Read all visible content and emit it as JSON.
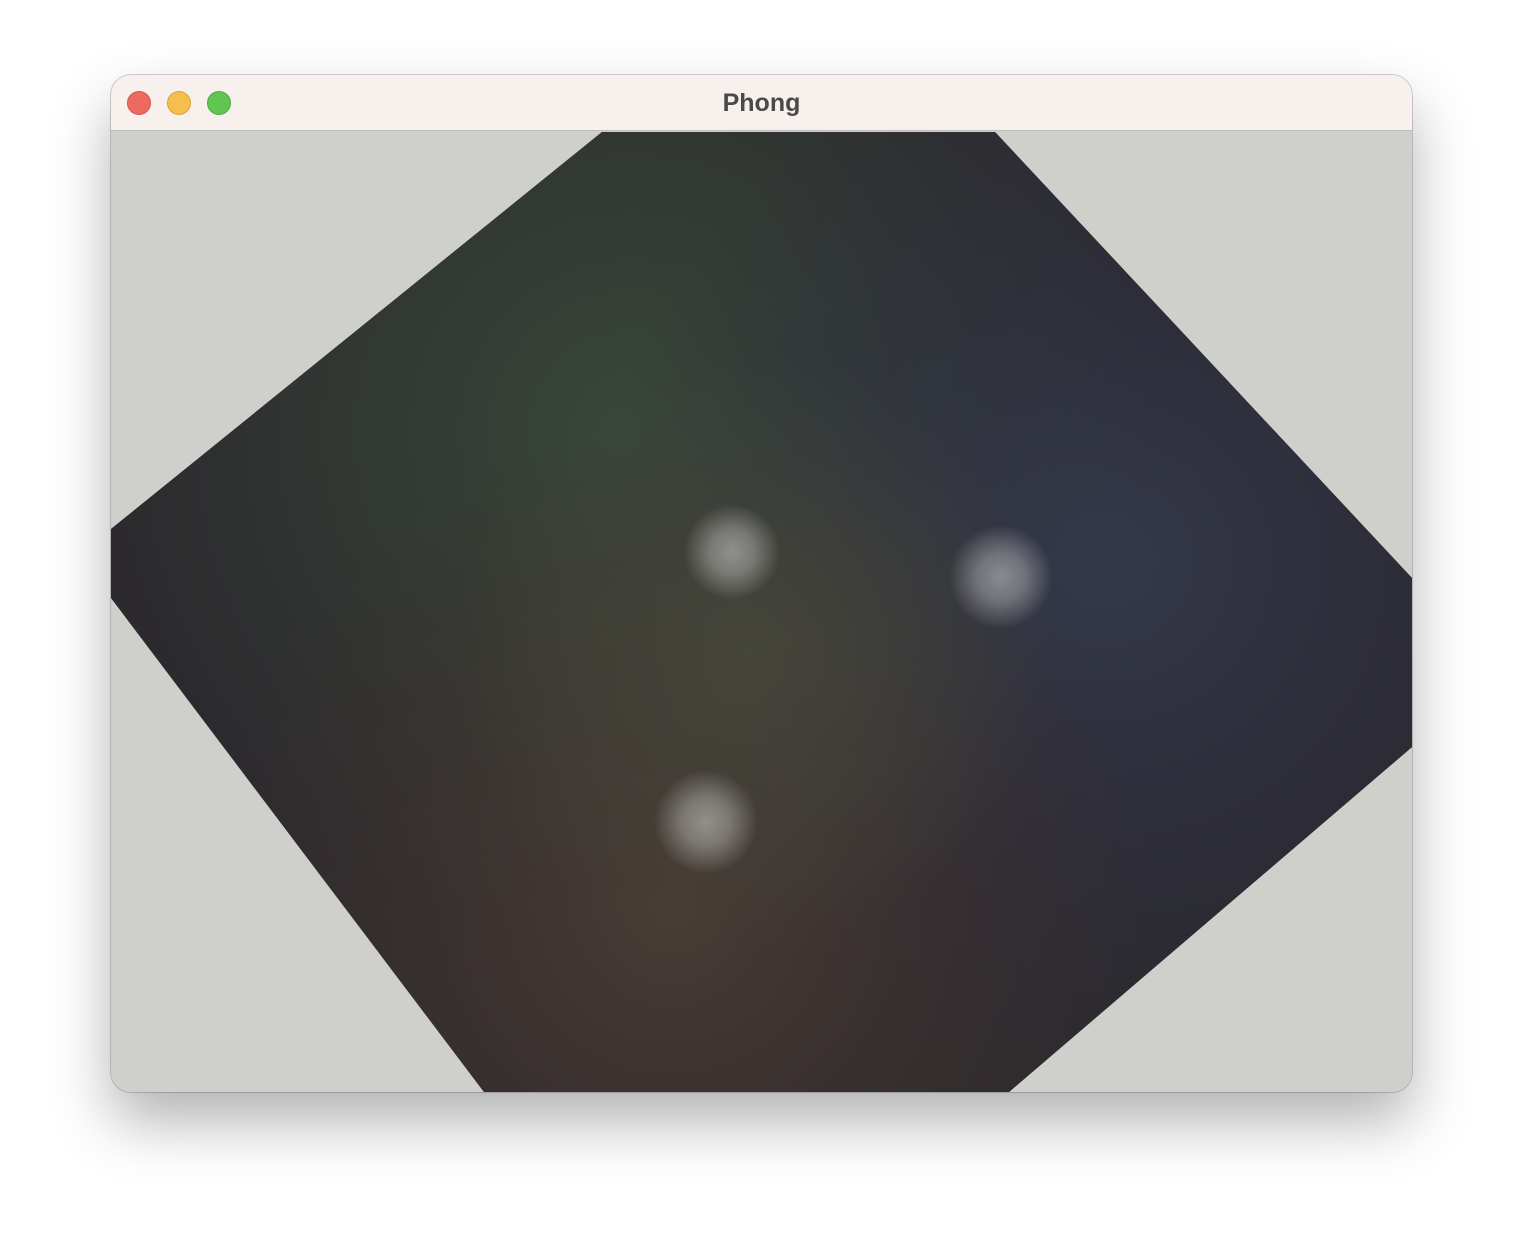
{
  "window": {
    "title": "Phong"
  },
  "traffic_lights": {
    "close": "#ee6a5e",
    "minimize": "#f5bf4f",
    "maximize": "#61c554"
  },
  "canvas": {
    "background": "#cfcfcb",
    "shape": "lit polygon with three point-light highlights"
  }
}
